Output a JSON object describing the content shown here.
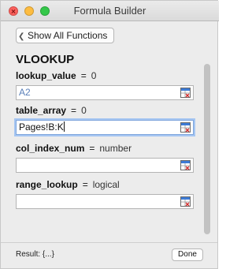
{
  "window": {
    "title": "Formula Builder"
  },
  "back_button": {
    "label": "Show All Functions"
  },
  "function": {
    "name": "VLOOKUP"
  },
  "params": [
    {
      "name": "lookup_value",
      "equals": "=",
      "hint": "0",
      "value": "A2"
    },
    {
      "name": "table_array",
      "equals": "=",
      "hint": "0",
      "value": "Pages!B:K"
    },
    {
      "name": "col_index_num",
      "equals": "=",
      "hint": "number",
      "value": ""
    },
    {
      "name": "range_lookup",
      "equals": "=",
      "hint": "logical",
      "value": ""
    }
  ],
  "footer": {
    "result": "Result: {...}",
    "done_label": "Done"
  }
}
